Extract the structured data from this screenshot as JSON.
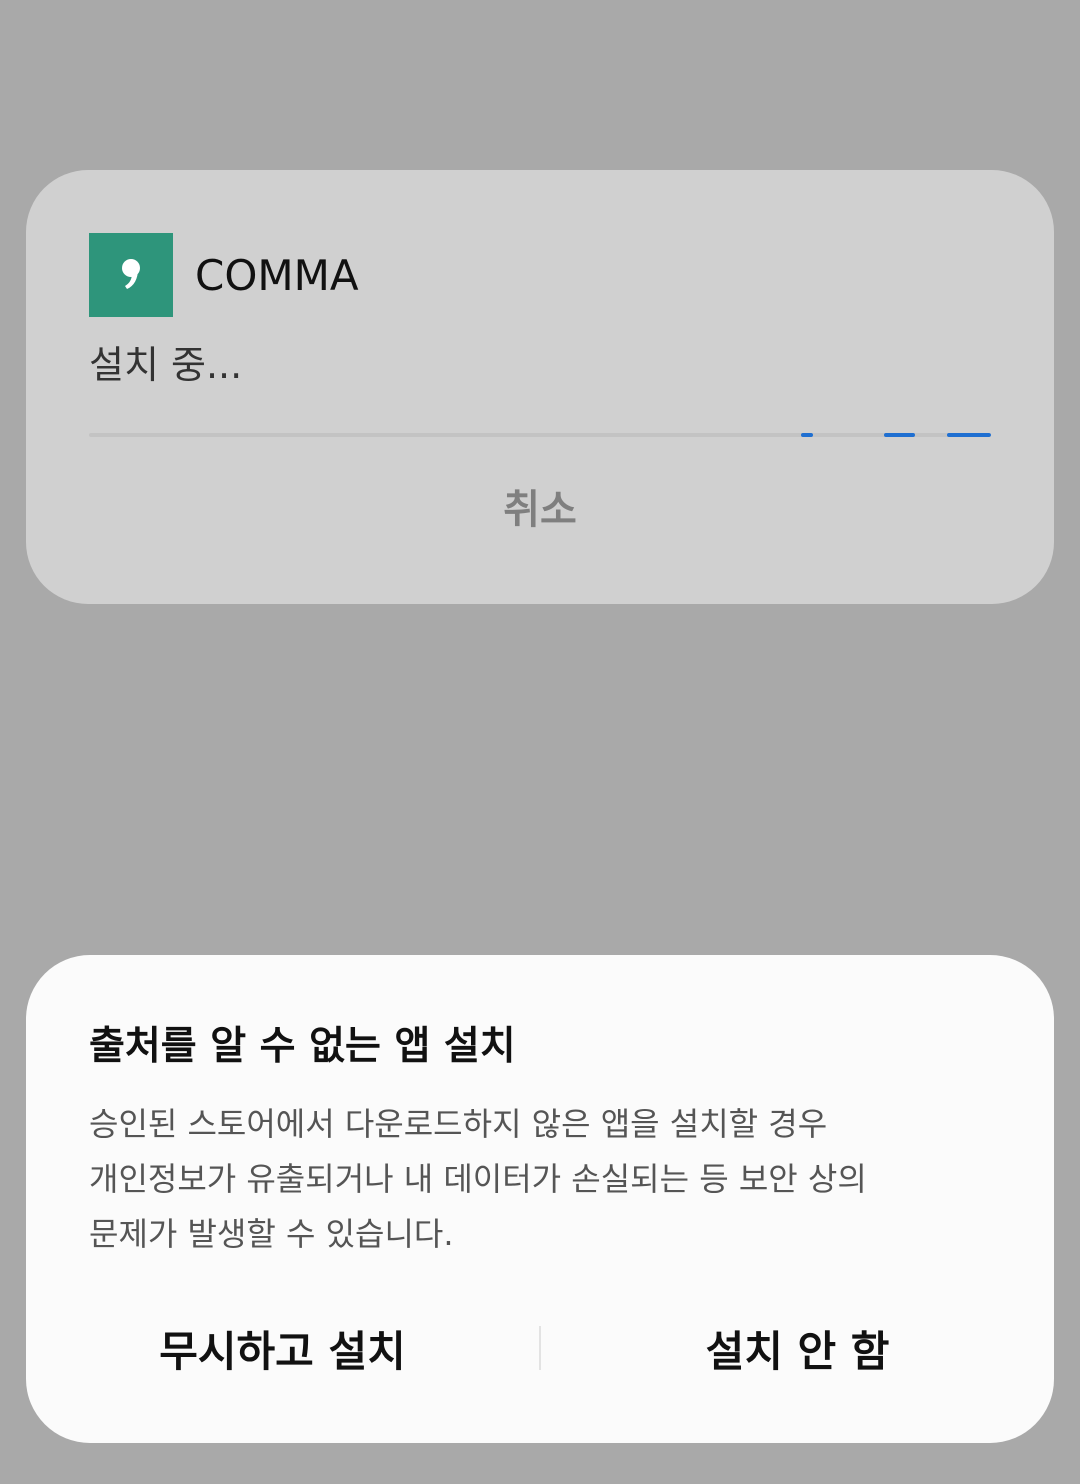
{
  "install_card": {
    "app_icon": "comma-app-icon",
    "app_name": "COMMA",
    "status": "설치 중...",
    "cancel_label": "취소",
    "progress_indeterminate": true,
    "progress_color": "#1f6fd1",
    "icon_color": "#2e957b"
  },
  "warning_dialog": {
    "title": "출처를 알 수 없는 앱 설치",
    "message_lines": [
      "승인된 스토어에서 다운로드하지 않은 앱을 설치할 경우",
      "개인정보가 유출되거나 내 데이터가 손실되는 등 보안 상의",
      "문제가 발생할 수 있습니다."
    ],
    "ignore_install_label": "무시하고 설치",
    "dont_install_label": "설치 안 함"
  }
}
